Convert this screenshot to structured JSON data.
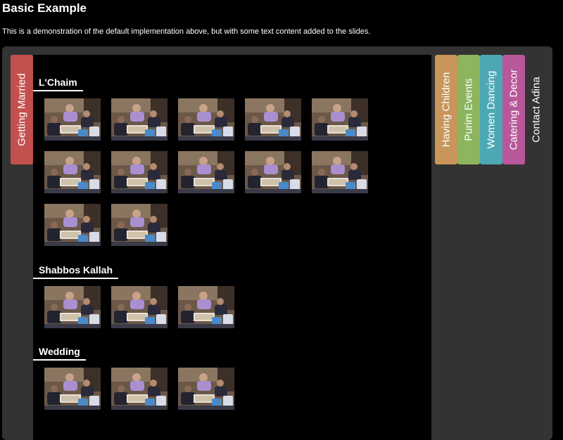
{
  "header": {
    "title": "Basic Example",
    "description": "This is a demonstration of the default implementation above, but with some text content added to the slides."
  },
  "tabs": [
    {
      "label": "Getting Married",
      "color": "#c4504d",
      "active": true
    },
    {
      "label": "Having Children",
      "color": "#c8955a",
      "active": false
    },
    {
      "label": "Purim Events",
      "color": "#8cb55d",
      "active": false
    },
    {
      "label": "Women Dancing",
      "color": "#4da8b5",
      "active": false
    },
    {
      "label": "Catering & Decor",
      "color": "#b8579a",
      "active": false
    },
    {
      "label": "Contact Adina",
      "color": "#333333",
      "active": false
    }
  ],
  "sections": [
    {
      "title": "L'Chaim",
      "thumb_count": 12
    },
    {
      "title": "Shabbos Kallah",
      "thumb_count": 3
    },
    {
      "title": "Wedding",
      "thumb_count": 3
    }
  ]
}
